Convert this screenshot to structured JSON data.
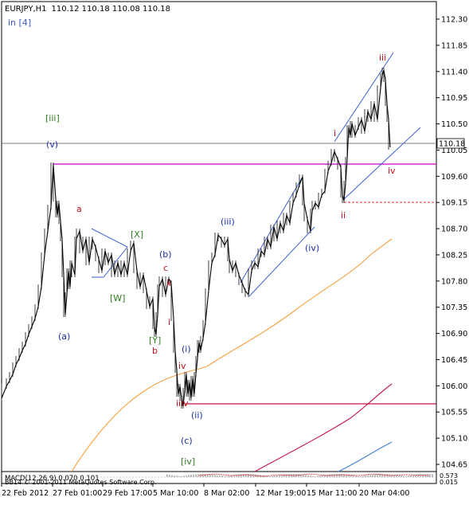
{
  "header": {
    "symbol_tf": "EURJPY,H1",
    "ohlc": "110.12 110.18 110.08 110.18",
    "subtitle": "in [4]"
  },
  "price_axis": {
    "ticks": [
      "112.30",
      "111.85",
      "111.40",
      "110.95",
      "110.50",
      "110.05",
      "109.60",
      "109.15",
      "108.70",
      "108.25",
      "107.80",
      "107.35",
      "106.90",
      "106.45",
      "106.00",
      "105.55",
      "105.10",
      "104.65"
    ],
    "current_price": "110.18"
  },
  "time_axis": {
    "ticks": [
      "22 Feb 2012",
      "27 Feb 01:00",
      "29 Feb 17:00",
      "5 Mar 10:00",
      "8 Mar 02:00",
      "12 Mar 19:00",
      "15 Mar 11:00",
      "20 Mar 04:00"
    ]
  },
  "wave_labels": [
    {
      "text": "[iii]",
      "color": "#2e7d1f"
    },
    {
      "text": "(v)",
      "color": "#1a2fa8"
    },
    {
      "text": "a",
      "color": "#c0121b"
    },
    {
      "text": "[X]",
      "color": "#2e7d1f"
    },
    {
      "text": "[W]",
      "color": "#2e7d1f"
    },
    {
      "text": "(b)",
      "color": "#1a2fa8"
    },
    {
      "text": "c",
      "color": "#c0121b"
    },
    {
      "text": "ii",
      "color": "#c0121b"
    },
    {
      "text": "i",
      "color": "#c0121b"
    },
    {
      "text": "[Y]",
      "color": "#2e7d1f"
    },
    {
      "text": "b",
      "color": "#c0121b"
    },
    {
      "text": "(a)",
      "color": "#1a2fa8"
    },
    {
      "text": "(i)",
      "color": "#1a2fa8"
    },
    {
      "text": "iv",
      "color": "#c0121b"
    },
    {
      "text": "iii",
      "color": "#c0121b"
    },
    {
      "text": "v",
      "color": "#c0121b"
    },
    {
      "text": "(ii)",
      "color": "#1a2fa8"
    },
    {
      "text": "(c)",
      "color": "#1a2fa8"
    },
    {
      "text": "[iv]",
      "color": "#2e7d1f"
    },
    {
      "text": "(iii)",
      "color": "#1a2fa8"
    },
    {
      "text": "(iv)",
      "color": "#1a2fa8"
    },
    {
      "text": "i",
      "color": "#c0121b"
    },
    {
      "text": "ii",
      "color": "#c0121b"
    },
    {
      "text": "iii",
      "color": "#c0121b"
    },
    {
      "text": "iv",
      "color": "#c0121b"
    }
  ],
  "indicator": {
    "label": "MACD(12,26,9) 0.070 0.101",
    "value_top": "0.573",
    "value_bottom": "0.015"
  },
  "footer": {
    "copyright": "BB14 © 2001-2011 MetaQuotes Software Corp."
  },
  "colors": {
    "price_line": "#000000",
    "magenta_line": "#cc00cc",
    "channel": "#3d5fd1",
    "ma_orange": "#f5a040",
    "ma_crimson": "#c8154a",
    "ma_blue": "#3d7fd1",
    "support_red": "#e02020"
  }
}
